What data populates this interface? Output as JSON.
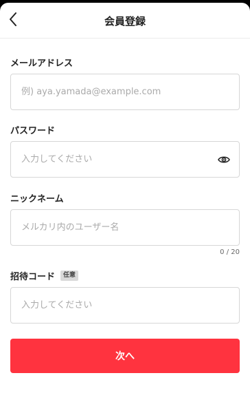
{
  "header": {
    "title": "会員登録",
    "back_icon": "chevron-left-icon"
  },
  "form": {
    "email": {
      "label": "メールアドレス",
      "placeholder": "例) aya.yamada@example.com",
      "value": ""
    },
    "password": {
      "label": "パスワード",
      "placeholder": "入力してください",
      "value": "",
      "toggle_icon": "eye-icon"
    },
    "nickname": {
      "label": "ニックネーム",
      "placeholder": "メルカリ内のユーザー名",
      "value": "",
      "counter": "0 / 20"
    },
    "invite_code": {
      "label": "招待コード",
      "badge": "任意",
      "placeholder": "入力してください",
      "value": ""
    }
  },
  "actions": {
    "next_label": "次へ"
  },
  "colors": {
    "accent": "#ff333f",
    "border": "#d6d6d6",
    "placeholder": "#aaaaaa",
    "badge_bg": "#d9d9d9"
  }
}
